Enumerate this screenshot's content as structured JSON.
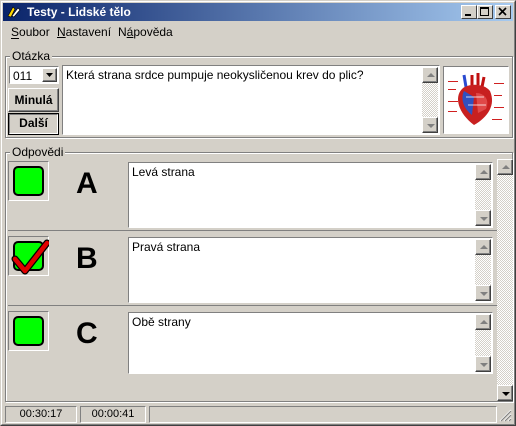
{
  "window": {
    "title": "Testy - Lidské tělo"
  },
  "menu": {
    "items": [
      {
        "label": "Soubor",
        "underline": "S"
      },
      {
        "label": "Nastavení",
        "underline": "N"
      },
      {
        "label": "Nápověda",
        "underline": "á"
      }
    ]
  },
  "question_group": {
    "label": "Otázka",
    "number": "011",
    "prev_label": "Minulá",
    "next_label": "Další",
    "question_text": "Která strana srdce pumpuje neokysličenou krev do plic?",
    "picture_icon": "heart-anatomy-image"
  },
  "answers_group": {
    "label": "Odpovědi",
    "answers": [
      {
        "letter": "A",
        "text": "Levá strana",
        "checked": false
      },
      {
        "letter": "B",
        "text": "Pravá strana",
        "checked": true
      },
      {
        "letter": "C",
        "text": "Obě strany",
        "checked": false
      }
    ]
  },
  "status": {
    "time_total": "00:30:17",
    "time_question": "00:00:41"
  },
  "colors": {
    "titlebar_start": "#0a246a",
    "titlebar_end": "#a6caf0",
    "answer_green": "#00ff00",
    "check_red": "#e00000"
  }
}
